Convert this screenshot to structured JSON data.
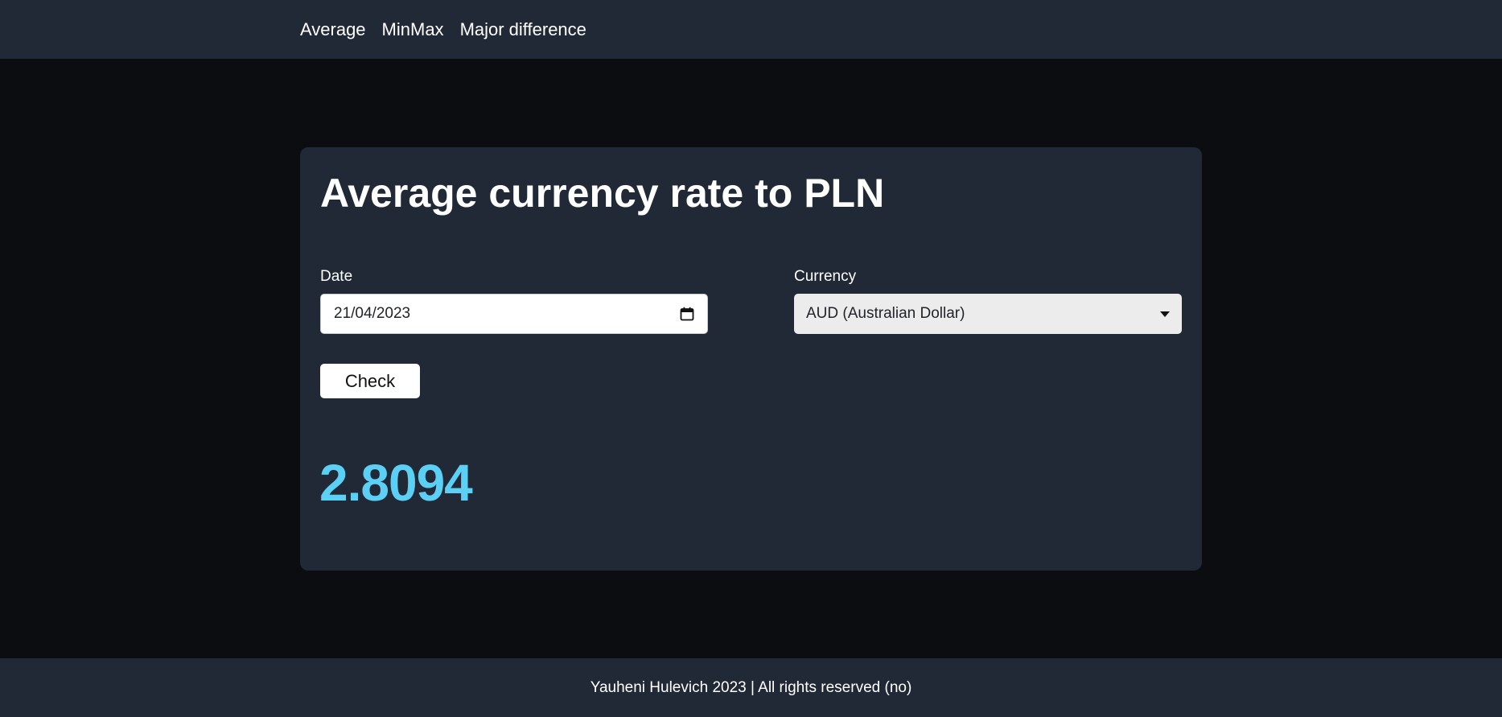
{
  "nav": {
    "links": [
      {
        "label": "Average"
      },
      {
        "label": "MinMax"
      },
      {
        "label": "Major difference"
      }
    ]
  },
  "card": {
    "title": "Average currency rate to PLN",
    "date_label": "Date",
    "date_value": "21/04/2023",
    "currency_label": "Currency",
    "currency_selected": "AUD (Australian Dollar)",
    "check_label": "Check",
    "result": "2.8094"
  },
  "footer": {
    "text": "Yauheni Hulevich 2023 | All rights reserved (no)"
  },
  "colors": {
    "page_bg": "#0b0d11",
    "panel_bg": "#212936",
    "result": "#5ccff4"
  },
  "icons": {
    "date_picker": "calendar-icon",
    "select_dropdown": "caret-down-icon"
  }
}
